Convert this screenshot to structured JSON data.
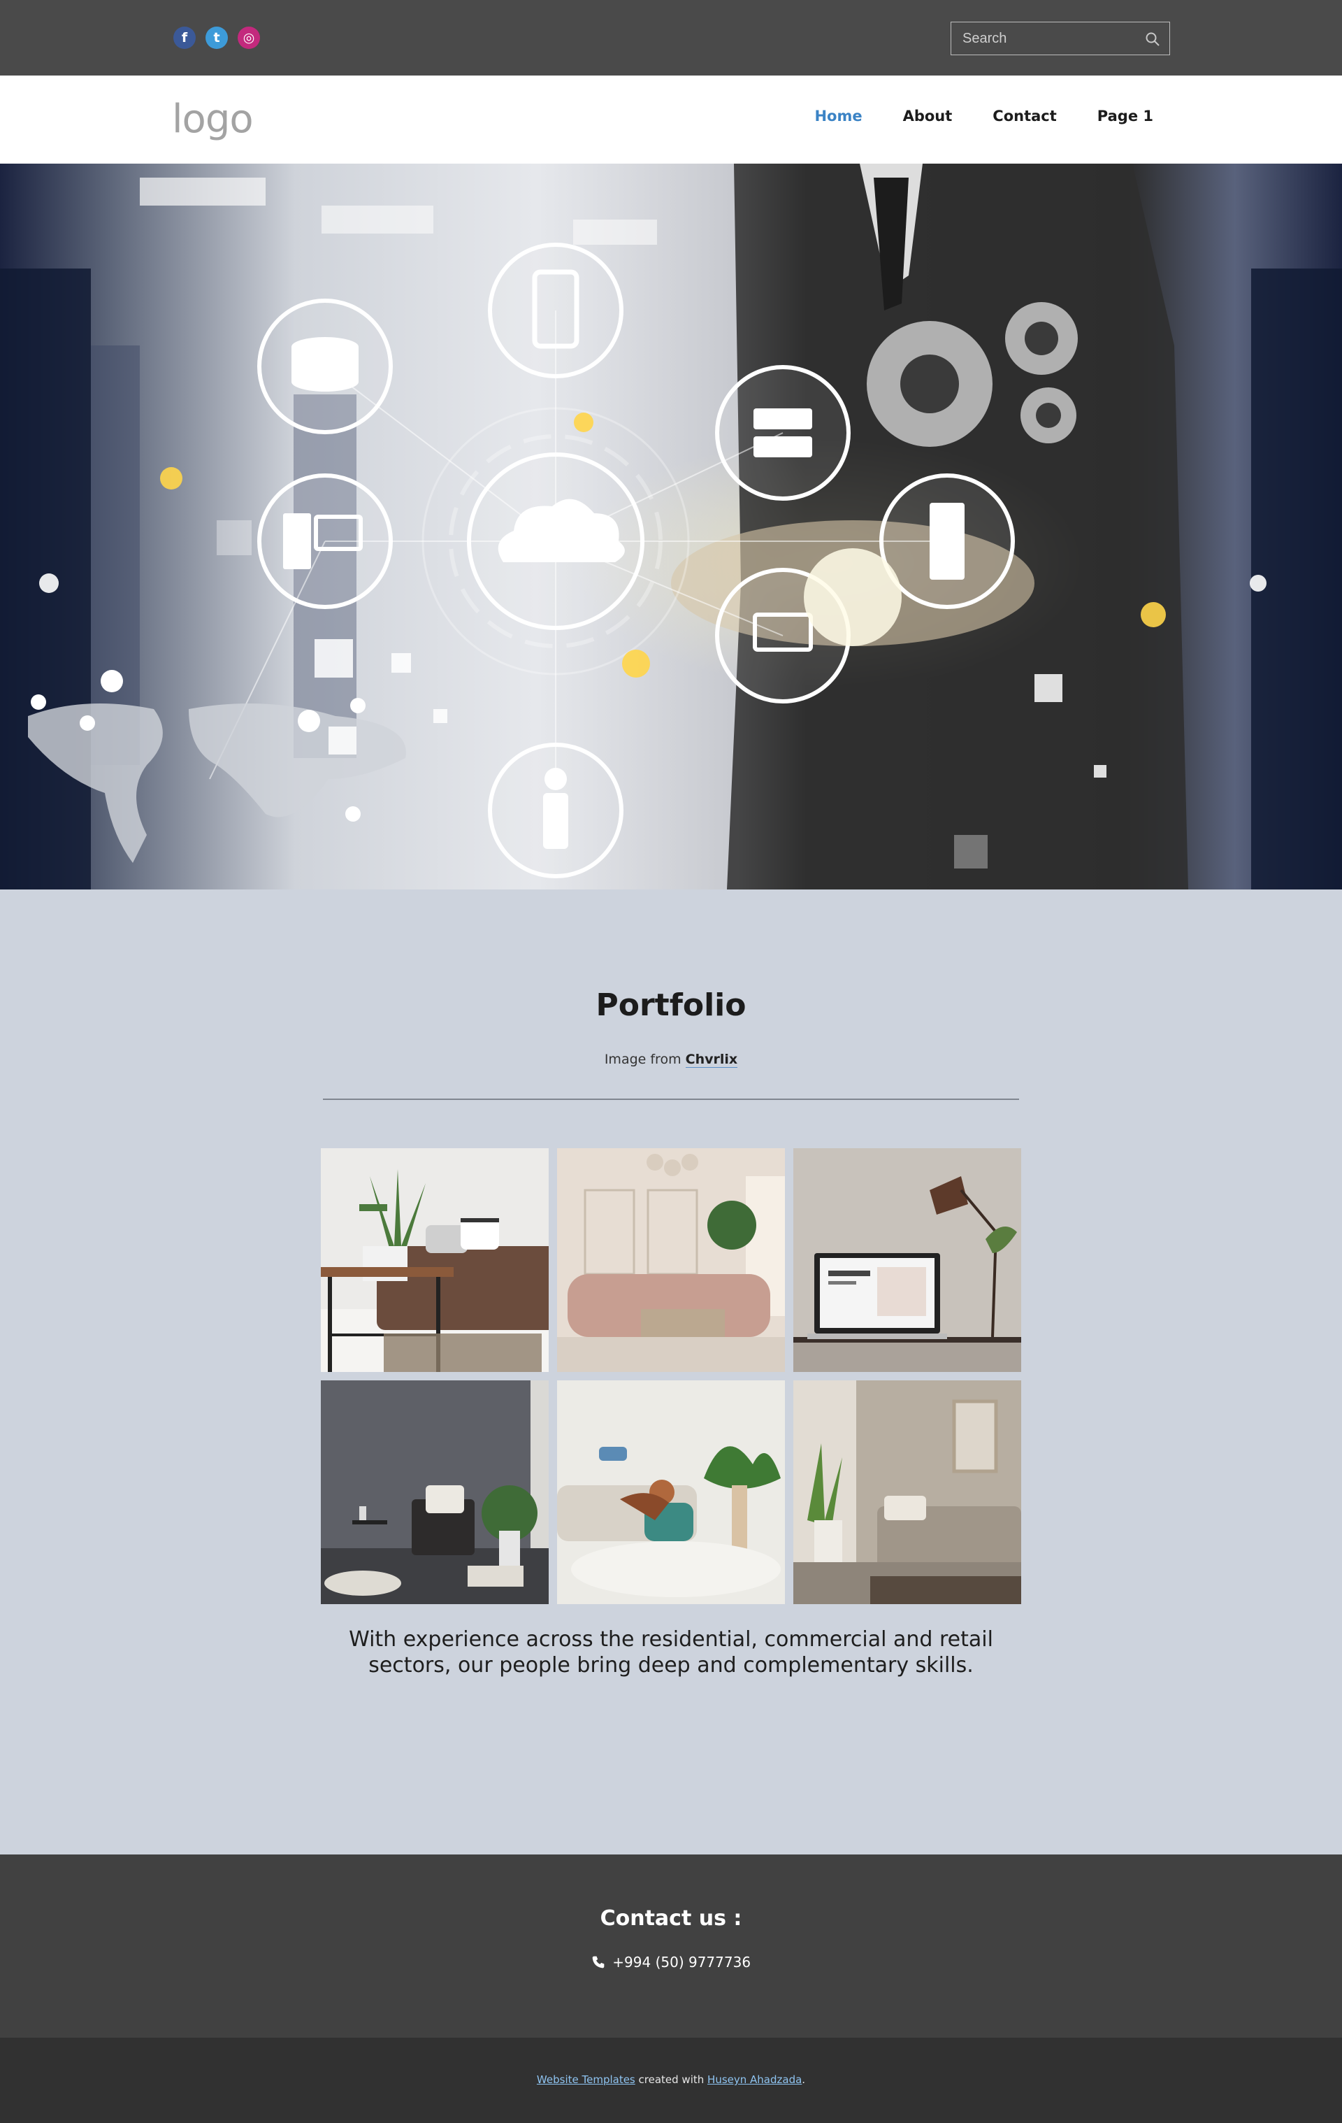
{
  "topbar": {
    "social": [
      {
        "icon": "facebook-icon",
        "glyph": "f",
        "color": "#3b5998"
      },
      {
        "icon": "twitter-icon",
        "glyph": "t",
        "color": "#3d9bd9"
      },
      {
        "icon": "instagram-icon",
        "glyph": "◎",
        "color": "#c3297d"
      }
    ],
    "search_placeholder": "Search",
    "search_icon": "search-icon"
  },
  "header": {
    "logo": "logo",
    "nav": [
      {
        "label": "Home",
        "active": true
      },
      {
        "label": "About",
        "active": false
      },
      {
        "label": "Contact",
        "active": false
      },
      {
        "label": "Page 1",
        "active": false
      }
    ],
    "active_color": "#3b83c5"
  },
  "hero": {
    "image": "technology-network-hero-image"
  },
  "portfolio": {
    "title": "Portfolio",
    "credit_prefix": "Image from",
    "credit_link": "Chvrlix",
    "images": [
      "brown-sofa-aloe-plant-photo",
      "pink-sofa-living-room-photo",
      "laptop-desk-lamp-photo",
      "dark-armchair-plant-photo",
      "couple-playing-guitar-photo",
      "beige-sofa-room-photo"
    ],
    "tagline": "With experience across the residential, commercial and retail sectors, our people bring deep and complementary skills."
  },
  "footer": {
    "contact_title": "Contact us :",
    "phone": "+994 (50) 9777736",
    "phone_icon": "phone-icon",
    "credit_link1": "Website Templates",
    "credit_middle": "created with",
    "credit_link2": "Huseyn Ahadzada",
    "credit_end": "."
  },
  "colors": {
    "topbar_bg": "#4a4a4a",
    "page_bg": "#cdd3dd",
    "footer_bg": "#414141",
    "bottom_bg": "#313131"
  }
}
